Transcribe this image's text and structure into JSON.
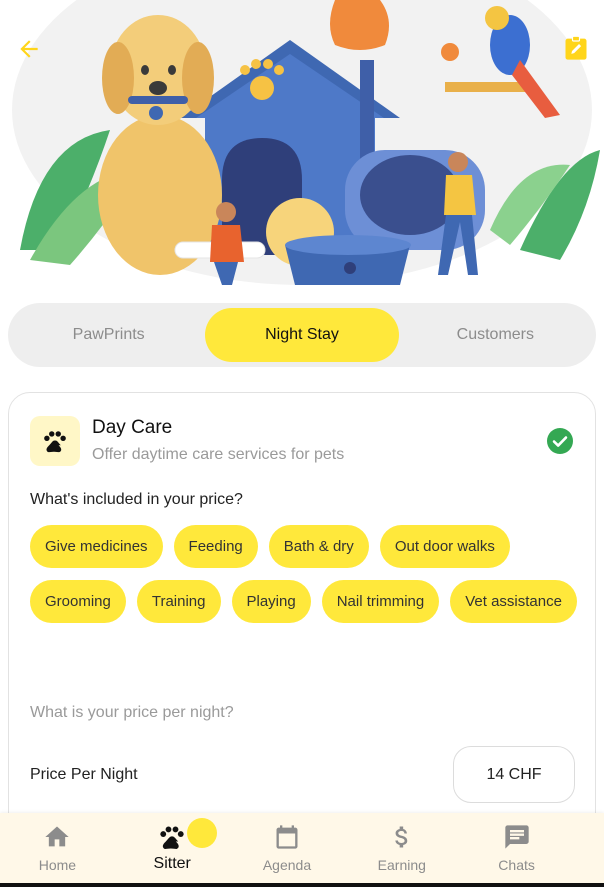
{
  "header": {
    "back_icon": "arrow-left-icon",
    "edit_icon": "edit-note-icon",
    "accent_color": "#ffe83b"
  },
  "tabs": [
    {
      "label": "PawPrints",
      "active": false
    },
    {
      "label": "Night Stay",
      "active": true
    },
    {
      "label": "Customers",
      "active": false
    }
  ],
  "service": {
    "icon": "paw-icon",
    "title": "Day Care",
    "subtitle": "Offer daytime care services for pets",
    "selected": true,
    "check_color": "#34a853"
  },
  "included": {
    "question": "What's included in your price?",
    "items": [
      "Give medicines",
      "Feeding",
      "Bath & dry",
      "Out door walks",
      "Grooming",
      "Training",
      "Playing",
      "Nail trimming",
      "Vet assistance"
    ]
  },
  "price": {
    "question": "What is your price per night?",
    "label": "Price Per Night",
    "value": "14 CHF"
  },
  "bottom_nav": [
    {
      "label": "Home",
      "icon": "home-icon",
      "active": false
    },
    {
      "label": "Sitter",
      "icon": "paw-icon",
      "active": true
    },
    {
      "label": "Agenda",
      "icon": "calendar-icon",
      "active": false
    },
    {
      "label": "Earning",
      "icon": "dollar-icon",
      "active": false
    },
    {
      "label": "Chats",
      "icon": "chat-icon",
      "active": false
    }
  ]
}
